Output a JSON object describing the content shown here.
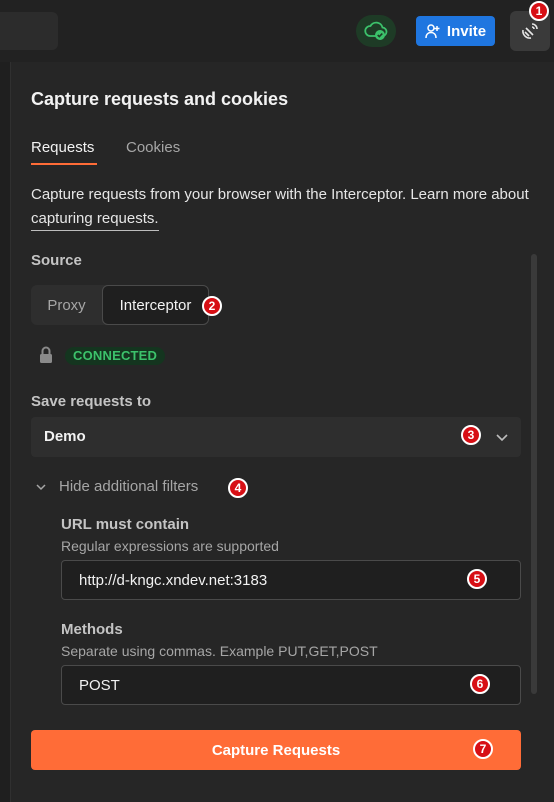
{
  "header": {
    "invite_label": "Invite"
  },
  "panel": {
    "title": "Capture requests and cookies",
    "tabs": [
      {
        "label": "Requests",
        "active": true
      },
      {
        "label": "Cookies",
        "active": false
      }
    ],
    "description_text": "Capture requests from your browser with the Interceptor. Learn more about ",
    "description_link": "capturing requests."
  },
  "source": {
    "label": "Source",
    "options": [
      "Proxy",
      "Interceptor"
    ],
    "selected": "Interceptor",
    "status": "CONNECTED"
  },
  "save_to": {
    "label": "Save requests to",
    "value": "Demo"
  },
  "filters": {
    "toggle_label": "Hide additional filters",
    "url": {
      "label": "URL must contain",
      "help": "Regular expressions are supported",
      "value": "http://d-kngc.xndev.net:3183"
    },
    "methods": {
      "label": "Methods",
      "help": "Separate using commas. Example PUT,GET,POST",
      "value": "POST"
    }
  },
  "primary_button": "Capture Requests",
  "markers": [
    "1",
    "2",
    "3",
    "4",
    "5",
    "6",
    "7"
  ],
  "colors": {
    "accent": "#ff6c37",
    "invite": "#1f76e0",
    "connected": "#3cc26b",
    "marker": "#d70f15"
  },
  "icons": [
    "cloud-check-icon",
    "add-user-icon",
    "satellite-capture-icon",
    "lock-icon",
    "chevron-down-icon"
  ]
}
